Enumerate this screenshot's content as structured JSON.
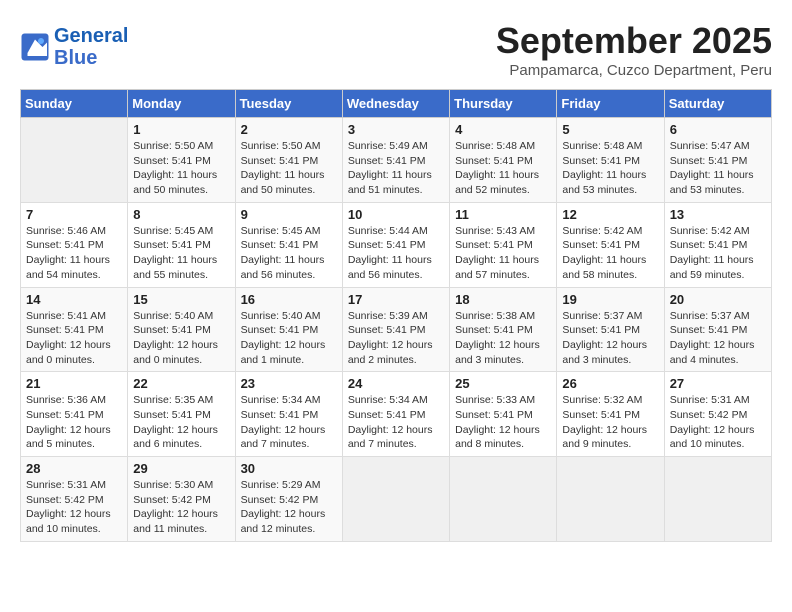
{
  "logo": {
    "line1": "General",
    "line2": "Blue"
  },
  "title": "September 2025",
  "location": "Pampamarca, Cuzco Department, Peru",
  "days_of_week": [
    "Sunday",
    "Monday",
    "Tuesday",
    "Wednesday",
    "Thursday",
    "Friday",
    "Saturday"
  ],
  "weeks": [
    [
      {
        "day": "",
        "sunrise": "",
        "sunset": "",
        "daylight": ""
      },
      {
        "day": "1",
        "sunrise": "Sunrise: 5:50 AM",
        "sunset": "Sunset: 5:41 PM",
        "daylight": "Daylight: 11 hours and 50 minutes."
      },
      {
        "day": "2",
        "sunrise": "Sunrise: 5:50 AM",
        "sunset": "Sunset: 5:41 PM",
        "daylight": "Daylight: 11 hours and 50 minutes."
      },
      {
        "day": "3",
        "sunrise": "Sunrise: 5:49 AM",
        "sunset": "Sunset: 5:41 PM",
        "daylight": "Daylight: 11 hours and 51 minutes."
      },
      {
        "day": "4",
        "sunrise": "Sunrise: 5:48 AM",
        "sunset": "Sunset: 5:41 PM",
        "daylight": "Daylight: 11 hours and 52 minutes."
      },
      {
        "day": "5",
        "sunrise": "Sunrise: 5:48 AM",
        "sunset": "Sunset: 5:41 PM",
        "daylight": "Daylight: 11 hours and 53 minutes."
      },
      {
        "day": "6",
        "sunrise": "Sunrise: 5:47 AM",
        "sunset": "Sunset: 5:41 PM",
        "daylight": "Daylight: 11 hours and 53 minutes."
      }
    ],
    [
      {
        "day": "7",
        "sunrise": "Sunrise: 5:46 AM",
        "sunset": "Sunset: 5:41 PM",
        "daylight": "Daylight: 11 hours and 54 minutes."
      },
      {
        "day": "8",
        "sunrise": "Sunrise: 5:45 AM",
        "sunset": "Sunset: 5:41 PM",
        "daylight": "Daylight: 11 hours and 55 minutes."
      },
      {
        "day": "9",
        "sunrise": "Sunrise: 5:45 AM",
        "sunset": "Sunset: 5:41 PM",
        "daylight": "Daylight: 11 hours and 56 minutes."
      },
      {
        "day": "10",
        "sunrise": "Sunrise: 5:44 AM",
        "sunset": "Sunset: 5:41 PM",
        "daylight": "Daylight: 11 hours and 56 minutes."
      },
      {
        "day": "11",
        "sunrise": "Sunrise: 5:43 AM",
        "sunset": "Sunset: 5:41 PM",
        "daylight": "Daylight: 11 hours and 57 minutes."
      },
      {
        "day": "12",
        "sunrise": "Sunrise: 5:42 AM",
        "sunset": "Sunset: 5:41 PM",
        "daylight": "Daylight: 11 hours and 58 minutes."
      },
      {
        "day": "13",
        "sunrise": "Sunrise: 5:42 AM",
        "sunset": "Sunset: 5:41 PM",
        "daylight": "Daylight: 11 hours and 59 minutes."
      }
    ],
    [
      {
        "day": "14",
        "sunrise": "Sunrise: 5:41 AM",
        "sunset": "Sunset: 5:41 PM",
        "daylight": "Daylight: 12 hours and 0 minutes."
      },
      {
        "day": "15",
        "sunrise": "Sunrise: 5:40 AM",
        "sunset": "Sunset: 5:41 PM",
        "daylight": "Daylight: 12 hours and 0 minutes."
      },
      {
        "day": "16",
        "sunrise": "Sunrise: 5:40 AM",
        "sunset": "Sunset: 5:41 PM",
        "daylight": "Daylight: 12 hours and 1 minute."
      },
      {
        "day": "17",
        "sunrise": "Sunrise: 5:39 AM",
        "sunset": "Sunset: 5:41 PM",
        "daylight": "Daylight: 12 hours and 2 minutes."
      },
      {
        "day": "18",
        "sunrise": "Sunrise: 5:38 AM",
        "sunset": "Sunset: 5:41 PM",
        "daylight": "Daylight: 12 hours and 3 minutes."
      },
      {
        "day": "19",
        "sunrise": "Sunrise: 5:37 AM",
        "sunset": "Sunset: 5:41 PM",
        "daylight": "Daylight: 12 hours and 3 minutes."
      },
      {
        "day": "20",
        "sunrise": "Sunrise: 5:37 AM",
        "sunset": "Sunset: 5:41 PM",
        "daylight": "Daylight: 12 hours and 4 minutes."
      }
    ],
    [
      {
        "day": "21",
        "sunrise": "Sunrise: 5:36 AM",
        "sunset": "Sunset: 5:41 PM",
        "daylight": "Daylight: 12 hours and 5 minutes."
      },
      {
        "day": "22",
        "sunrise": "Sunrise: 5:35 AM",
        "sunset": "Sunset: 5:41 PM",
        "daylight": "Daylight: 12 hours and 6 minutes."
      },
      {
        "day": "23",
        "sunrise": "Sunrise: 5:34 AM",
        "sunset": "Sunset: 5:41 PM",
        "daylight": "Daylight: 12 hours and 7 minutes."
      },
      {
        "day": "24",
        "sunrise": "Sunrise: 5:34 AM",
        "sunset": "Sunset: 5:41 PM",
        "daylight": "Daylight: 12 hours and 7 minutes."
      },
      {
        "day": "25",
        "sunrise": "Sunrise: 5:33 AM",
        "sunset": "Sunset: 5:41 PM",
        "daylight": "Daylight: 12 hours and 8 minutes."
      },
      {
        "day": "26",
        "sunrise": "Sunrise: 5:32 AM",
        "sunset": "Sunset: 5:41 PM",
        "daylight": "Daylight: 12 hours and 9 minutes."
      },
      {
        "day": "27",
        "sunrise": "Sunrise: 5:31 AM",
        "sunset": "Sunset: 5:42 PM",
        "daylight": "Daylight: 12 hours and 10 minutes."
      }
    ],
    [
      {
        "day": "28",
        "sunrise": "Sunrise: 5:31 AM",
        "sunset": "Sunset: 5:42 PM",
        "daylight": "Daylight: 12 hours and 10 minutes."
      },
      {
        "day": "29",
        "sunrise": "Sunrise: 5:30 AM",
        "sunset": "Sunset: 5:42 PM",
        "daylight": "Daylight: 12 hours and 11 minutes."
      },
      {
        "day": "30",
        "sunrise": "Sunrise: 5:29 AM",
        "sunset": "Sunset: 5:42 PM",
        "daylight": "Daylight: 12 hours and 12 minutes."
      },
      {
        "day": "",
        "sunrise": "",
        "sunset": "",
        "daylight": ""
      },
      {
        "day": "",
        "sunrise": "",
        "sunset": "",
        "daylight": ""
      },
      {
        "day": "",
        "sunrise": "",
        "sunset": "",
        "daylight": ""
      },
      {
        "day": "",
        "sunrise": "",
        "sunset": "",
        "daylight": ""
      }
    ]
  ]
}
